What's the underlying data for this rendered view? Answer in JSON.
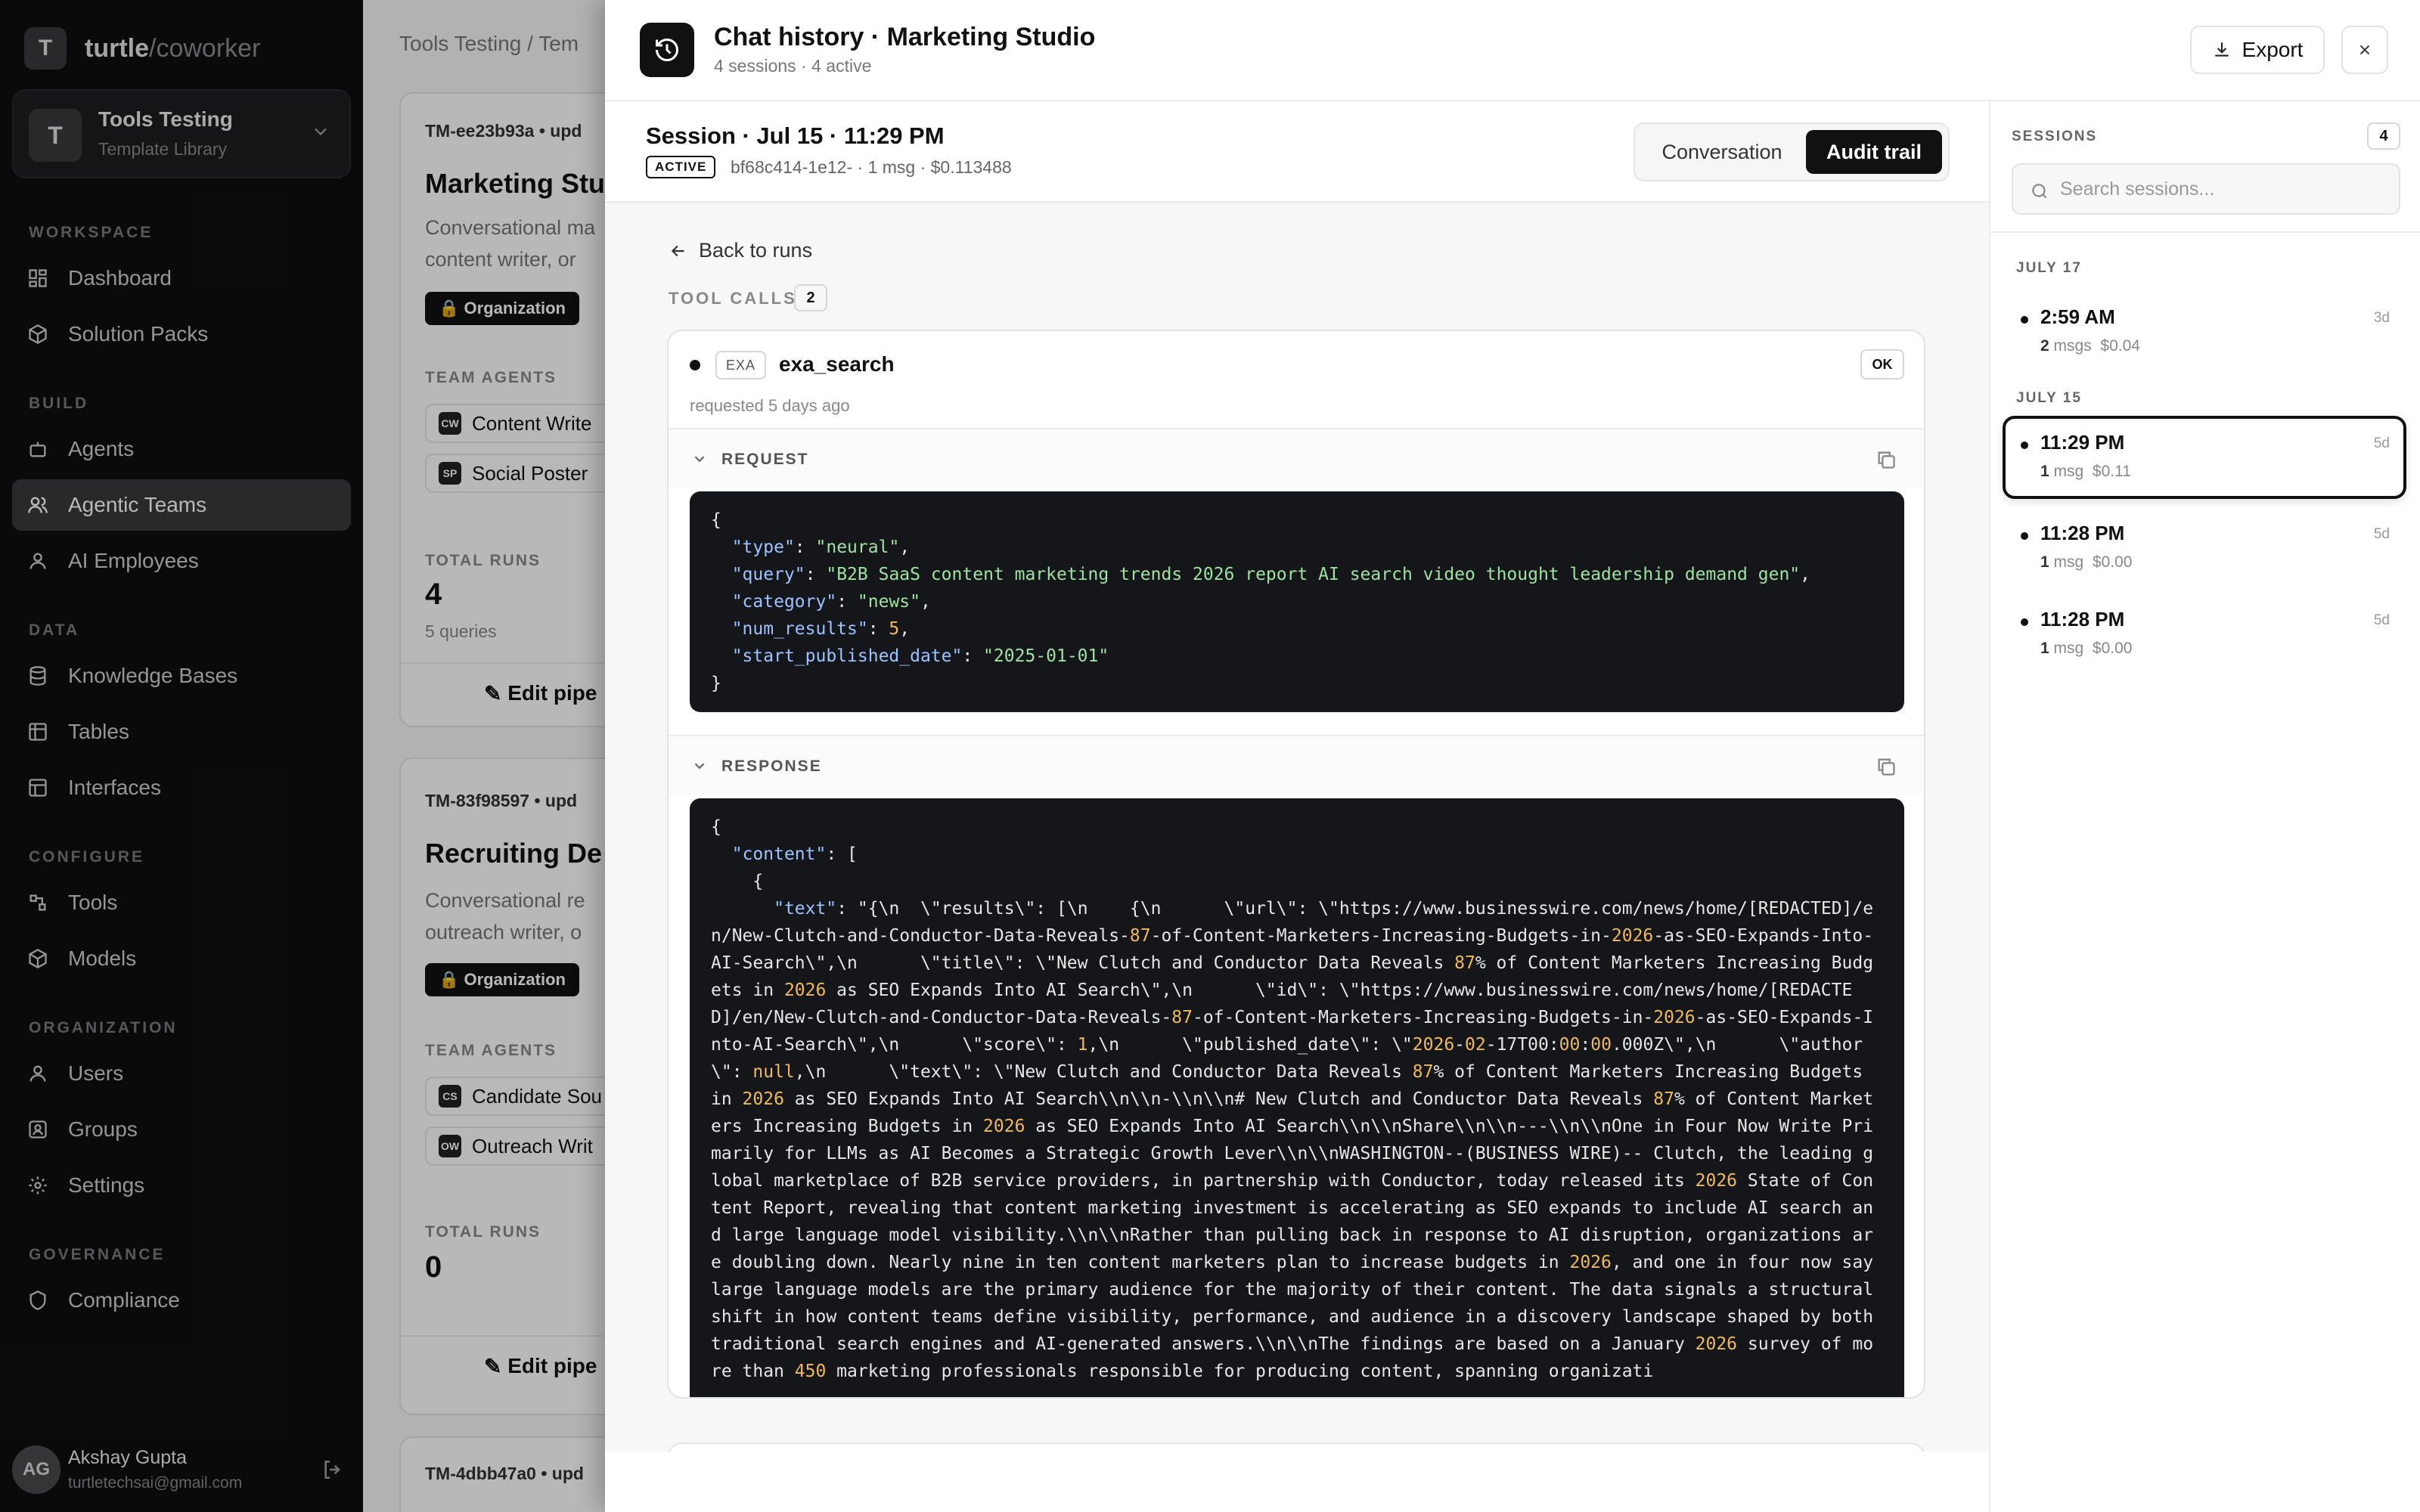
{
  "brand": {
    "mark": "T",
    "name": "turtle",
    "suffix": "/coworker"
  },
  "workspace": {
    "avatar": "T",
    "name": "Tools Testing",
    "subtitle": "Template Library"
  },
  "nav": {
    "sections": {
      "workspace": "WORKSPACE",
      "build": "BUILD",
      "data": "DATA",
      "configure": "CONFIGURE",
      "organization": "ORGANIZATION",
      "governance": "GOVERNANCE"
    },
    "items": {
      "dashboard": "Dashboard",
      "solution_packs": "Solution Packs",
      "agents": "Agents",
      "agentic_teams": "Agentic Teams",
      "ai_employees": "AI Employees",
      "knowledge_bases": "Knowledge Bases",
      "tables": "Tables",
      "interfaces": "Interfaces",
      "tools": "Tools",
      "models": "Models",
      "users": "Users",
      "groups": "Groups",
      "settings": "Settings",
      "compliance": "Compliance"
    },
    "active": "agentic_teams"
  },
  "user": {
    "initials": "AG",
    "name": "Akshay Gupta",
    "email": "turtletechsai@gmail.com"
  },
  "background_page": {
    "breadcrumb": "Tools Testing  /  Tem",
    "cards": [
      {
        "id": "TM-ee23b93a  •  upd",
        "title": "Marketing Stu",
        "desc1": "Conversational ma",
        "desc2": "content writer, or",
        "badge": "Organization",
        "agents_label": "TEAM AGENTS",
        "agents": [
          {
            "abbr": "CW",
            "name": "Content Write"
          },
          {
            "abbr": "SP",
            "name": "Social Poster"
          }
        ],
        "runs_label": "TOTAL RUNS",
        "runs": "4",
        "queries": "5 queries",
        "edit": "Edit pipe"
      },
      {
        "id": "TM-83f98597  •  upd",
        "title": "Recruiting De",
        "desc1": "Conversational re",
        "desc2": "outreach writer, o",
        "badge": "Organization",
        "agents_label": "TEAM AGENTS",
        "agents": [
          {
            "abbr": "CS",
            "name": "Candidate Sou"
          },
          {
            "abbr": "OW",
            "name": "Outreach Writ"
          }
        ],
        "runs_label": "TOTAL RUNS",
        "runs": "0",
        "edit": "Edit pipe"
      }
    ],
    "third_id": "TM-4dbb47a0  •  upd"
  },
  "drawer": {
    "title": "Chat history · Marketing Studio",
    "subtitle": "4 sessions · 4 active",
    "export_label": "Export",
    "session": {
      "title": "Session · Jul 15 · 11:29 PM",
      "status": "ACTIVE",
      "meta": "bf68c414-1e12- · 1 msg · $0.113488"
    },
    "tabs": {
      "conversation": "Conversation",
      "audit": "Audit trail",
      "selected": "audit"
    },
    "back_label": "Back to runs",
    "tool_calls_label": "TOOL CALLS",
    "tool_calls_count": "2",
    "tool_call": {
      "provider": "EXA",
      "name": "exa_search",
      "status": "OK",
      "requested": "requested 5 days ago",
      "request_label": "REQUEST",
      "response_label": "RESPONSE",
      "request": {
        "type": "neural",
        "query": "B2B SaaS content marketing trends 2026 report AI search video thought leadership demand gen",
        "category": "news",
        "num_results": 5,
        "start_published_date": "2025-01-01"
      },
      "response_key": "content",
      "response_text_key": "text",
      "response_text": "\"{\\n  \\\"results\\\": [\\n    {\\n      \\\"url\\\": \\\"https://www.businesswire.com/news/home/[REDACTED]/en/New-Clutch-and-Conductor-Data-Reveals-87-of-Content-Marketers-Increasing-Budgets-in-2026-as-SEO-Expands-Into-AI-Search\\\",\\n      \\\"title\\\": \\\"New Clutch and Conductor Data Reveals 87% of Content Marketers Increasing Budgets in 2026 as SEO Expands Into AI Search\\\",\\n      \\\"id\\\": \\\"https://www.businesswire.com/news/home/[REDACTED]/en/New-Clutch-and-Conductor-Data-Reveals-87-of-Content-Marketers-Increasing-Budgets-in-2026-as-SEO-Expands-Into-AI-Search\\\",\\n      \\\"score\\\": 1,\\n      \\\"published_date\\\": \\\"2026-02-17T00:00:00.000Z\\\",\\n      \\\"author\\\": null,\\n      \\\"text\\\": \\\"New Clutch and Conductor Data Reveals 87% of Content Marketers Increasing Budgets in 2026 as SEO Expands Into AI Search\\\\n\\\\n-\\\\n\\\\n# New Clutch and Conductor Data Reveals 87% of Content Marketers Increasing Budgets in 2026 as SEO Expands Into AI Search\\\\n\\\\nShare\\\\n\\\\n---\\\\n\\\\nOne in Four Now Write Primarily for LLMs as AI Becomes a Strategic Growth Lever\\\\n\\\\nWASHINGTON--(BUSINESS WIRE)-- Clutch, the leading global marketplace of B2B service providers, in partnership with Conductor, today released its 2026 State of Content Report, revealing that content marketing investment is accelerating as SEO expands to include AI search and large language model visibility.\\\\n\\\\nRather than pulling back in response to AI disruption, organizations are doubling down. Nearly nine in ten content marketers plan to increase budgets in 2026, and one in four now say large language models are the primary audience for the majority of their content. The data signals a structural shift in how content teams define visibility, performance, and audience in a discovery landscape shaped by both traditional search engines and AI-generated answers.\\\\n\\\\nThe findings are based on a January 2026 survey of more than 450 marketing professionals responsible for producing content, spanning organizati",
      "truncated": "..."
    }
  },
  "sessions_panel": {
    "label": "SESSIONS",
    "count": "4",
    "search_placeholder": "Search sessions...",
    "groups": [
      {
        "label": "JULY 17",
        "items": [
          {
            "time": "2:59 AM",
            "msgs": "2",
            "msgs_unit": "msgs",
            "cost": "$0.04",
            "age": "3d",
            "selected": false
          }
        ]
      },
      {
        "label": "JULY 15",
        "items": [
          {
            "time": "11:29 PM",
            "msgs": "1",
            "msgs_unit": "msg",
            "cost": "$0.11",
            "age": "5d",
            "selected": true
          },
          {
            "time": "11:28 PM",
            "msgs": "1",
            "msgs_unit": "msg",
            "cost": "$0.00",
            "age": "5d",
            "selected": false
          },
          {
            "time": "11:28 PM",
            "msgs": "1",
            "msgs_unit": "msg",
            "cost": "$0.00",
            "age": "5d",
            "selected": false
          }
        ]
      }
    ]
  }
}
